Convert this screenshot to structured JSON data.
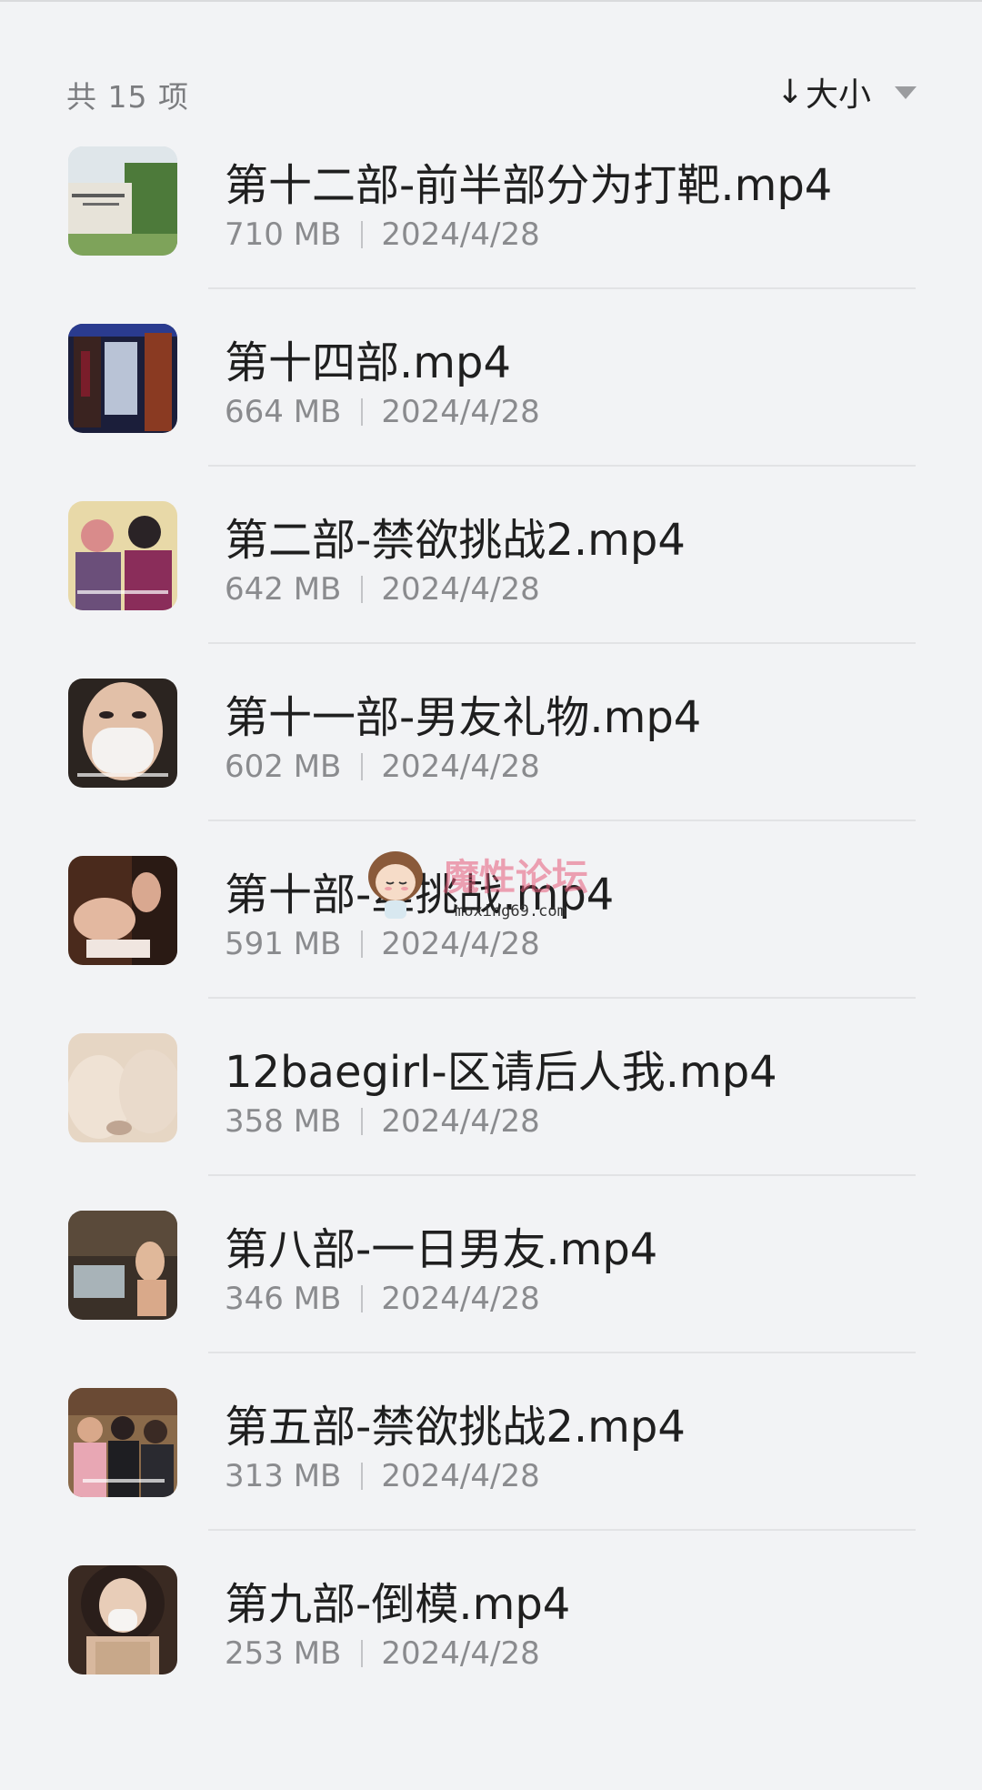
{
  "header": {
    "count_label": "共 15 项",
    "sort_label": "大小"
  },
  "files": [
    {
      "name": "第十二部-前半部分为打靶.mp4",
      "size": "710 MB",
      "date": "2024/4/28"
    },
    {
      "name": "第十四部.mp4",
      "size": "664 MB",
      "date": "2024/4/28"
    },
    {
      "name": "第二部-禁欲挑战2.mp4",
      "size": "642 MB",
      "date": "2024/4/28"
    },
    {
      "name": "第十一部-男友礼物.mp4",
      "size": "602 MB",
      "date": "2024/4/28"
    },
    {
      "name": "第十部-丝挑战.mp4",
      "size": "591 MB",
      "date": "2024/4/28"
    },
    {
      "name": "12baegirl-区请后人我.mp4",
      "size": "358 MB",
      "date": "2024/4/28"
    },
    {
      "name": "第八部-一日男友.mp4",
      "size": "346 MB",
      "date": "2024/4/28"
    },
    {
      "name": "第五部-禁欲挑战2.mp4",
      "size": "313 MB",
      "date": "2024/4/28"
    },
    {
      "name": "第九部-倒模.mp4",
      "size": "253 MB",
      "date": "2024/4/28"
    }
  ],
  "watermark": {
    "text": "魔性论坛",
    "url": "moxing69.com"
  },
  "colors": {
    "background": "#f2f3f5",
    "primary_text": "#1f1f1f",
    "secondary_text": "#8a8b8e"
  }
}
